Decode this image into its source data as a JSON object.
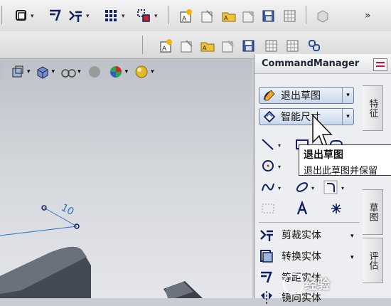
{
  "command_manager": {
    "title": "CommandManager",
    "tabs": [
      "特征",
      "草图",
      "评估"
    ],
    "exit_sketch_label": "退出草图",
    "smart_dimension_label": "智能尺寸",
    "trim_label": "剪裁实体",
    "convert_label": "转换实体",
    "offset_label": "等距实体",
    "mirror_label": "镜向实体"
  },
  "tooltip": {
    "title": "退出草图",
    "description": "退出此草图并保留"
  },
  "viewport": {
    "dimension_value": "10"
  },
  "watermark": {
    "text": "经验"
  },
  "colors": {
    "sketch_line": "#2a72c8",
    "accent_blue": "#102060",
    "button_bg": "#c9d6ea"
  }
}
